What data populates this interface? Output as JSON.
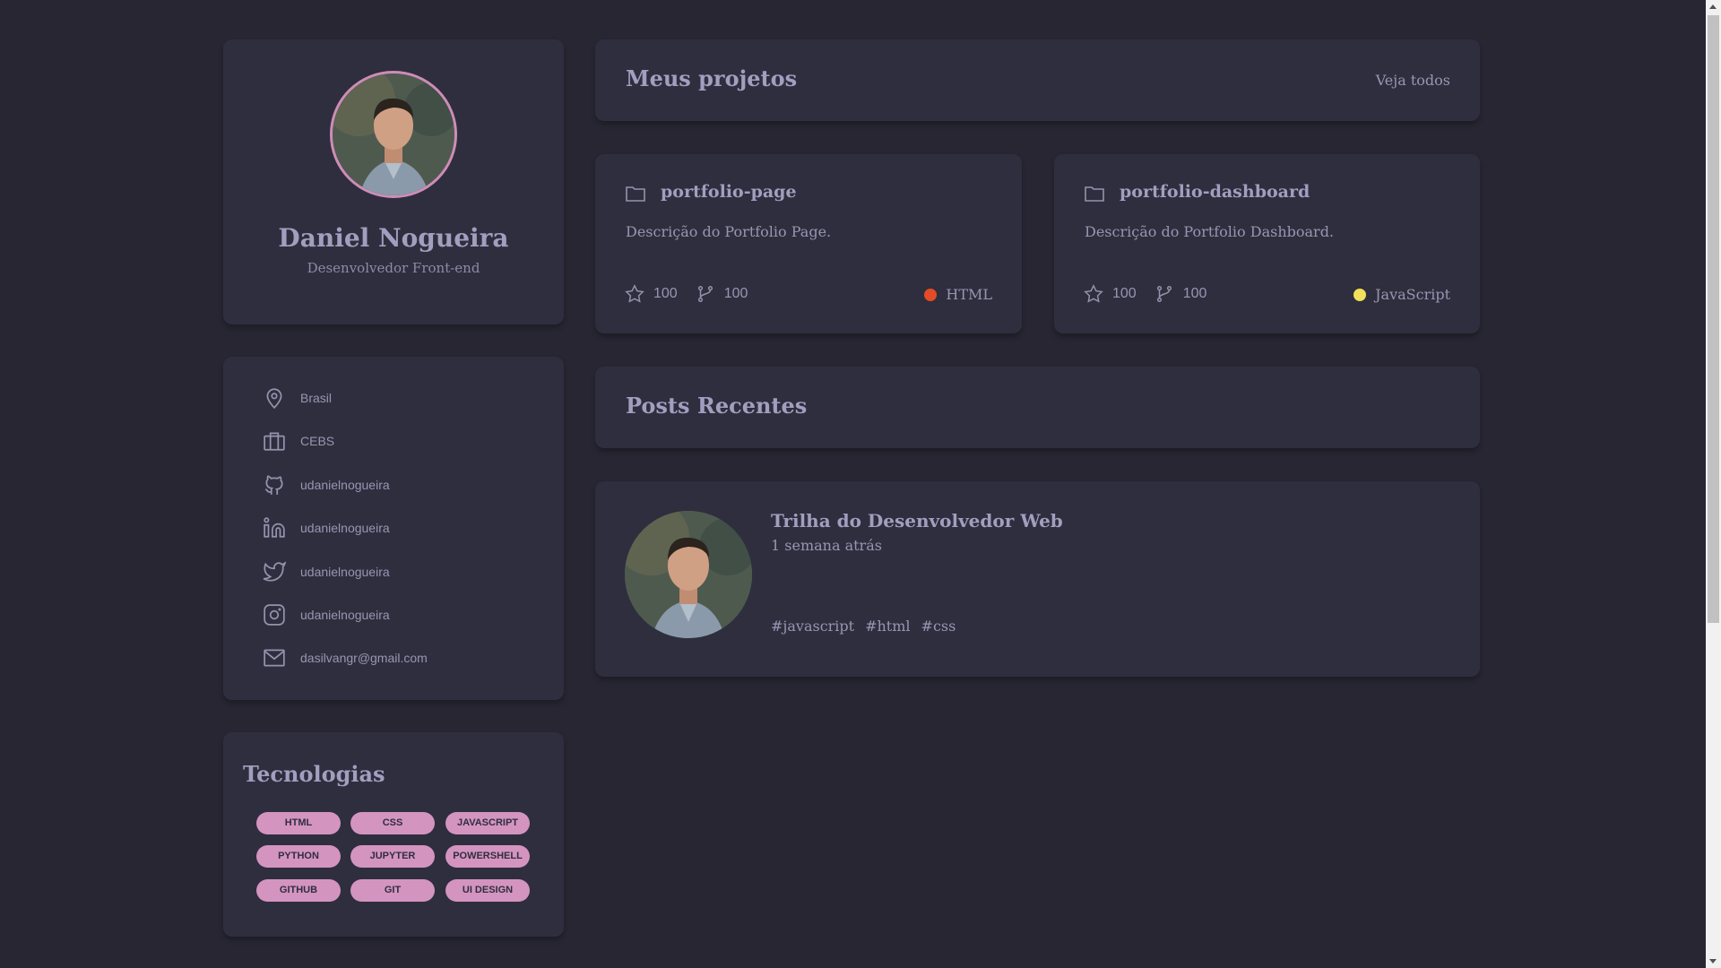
{
  "profile": {
    "name": "Daniel Nogueira",
    "role": "Desenvolvedor Front-end"
  },
  "info": {
    "items": [
      {
        "icon": "location-pin-icon",
        "label": "Brasil"
      },
      {
        "icon": "briefcase-icon",
        "label": "CEBS"
      },
      {
        "icon": "github-icon",
        "label": "udanielnogueira"
      },
      {
        "icon": "linkedin-icon",
        "label": "udanielnogueira"
      },
      {
        "icon": "twitter-icon",
        "label": "udanielnogueira"
      },
      {
        "icon": "instagram-icon",
        "label": "udanielnogueira"
      },
      {
        "icon": "mail-icon",
        "label": "dasilvangr@gmail.com"
      }
    ]
  },
  "tech": {
    "title": "Tecnologias",
    "tags": [
      "HTML",
      "CSS",
      "JAVASCRIPT",
      "PYTHON",
      "JUPYTER",
      "POWERSHELL",
      "GITHUB",
      "GIT",
      "UI DESIGN"
    ]
  },
  "projects": {
    "title": "Meus projetos",
    "see_all": "Veja todos",
    "items": [
      {
        "name": "portfolio-page",
        "description": "Descrição do Portfolio Page.",
        "stars": "100",
        "forks": "100",
        "language": "HTML",
        "language_color": "#e34c26"
      },
      {
        "name": "portfolio-dashboard",
        "description": "Descrição do Portfolio Dashboard.",
        "stars": "100",
        "forks": "100",
        "language": "JavaScript",
        "language_color": "#f1e05a"
      }
    ]
  },
  "posts": {
    "title": "Posts Recentes",
    "items": [
      {
        "title": "Trilha do Desenvolvedor Web",
        "time": "1 semana atrás",
        "tags": [
          "#javascript",
          "#html",
          "#css"
        ]
      }
    ]
  },
  "colors": {
    "background": "#272632",
    "card": "#2f2e3e",
    "text": "#a09fbf",
    "accent": "#d494c0"
  }
}
